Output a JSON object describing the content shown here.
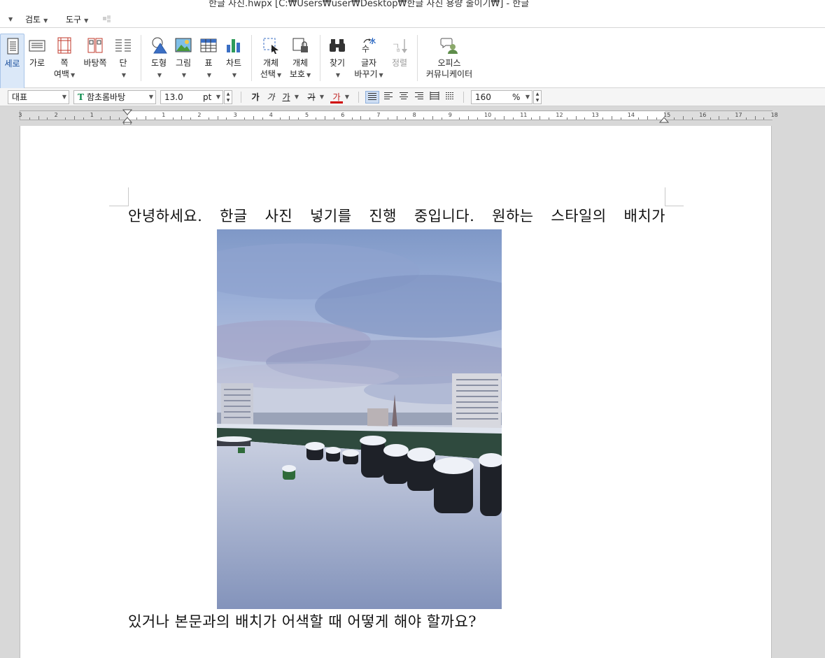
{
  "window": {
    "title": "한글 사진.hwpx [C:₩Users₩user₩Desktop₩한글 사진 용량 줄이기₩] - 한글"
  },
  "menu": {
    "items": [
      {
        "label": "검토"
      },
      {
        "label": "도구"
      }
    ]
  },
  "ribbon": {
    "buttons": [
      {
        "label": "세로",
        "icon": "portrait-page-icon"
      },
      {
        "label": "가로",
        "icon": "landscape-page-icon"
      },
      {
        "label": "쪽",
        "label2": "여백",
        "icon": "page-margin-icon"
      },
      {
        "label": "바탕쪽",
        "icon": "master-page-icon"
      },
      {
        "label": "단",
        "icon": "columns-icon"
      },
      {
        "label": "도형",
        "icon": "shape-icon"
      },
      {
        "label": "그림",
        "icon": "picture-icon"
      },
      {
        "label": "표",
        "icon": "table-icon"
      },
      {
        "label": "차트",
        "icon": "chart-icon"
      },
      {
        "label": "개체",
        "label2": "선택",
        "icon": "object-select-icon"
      },
      {
        "label": "개체",
        "label2": "보호",
        "icon": "object-protect-icon"
      },
      {
        "label": "찾기",
        "icon": "binoculars-icon"
      },
      {
        "label": "글자",
        "label2": "바꾸기",
        "icon": "char-convert-icon"
      },
      {
        "label": "정렬",
        "icon": "sort-icon"
      },
      {
        "label": "오피스",
        "label2": "커뮤니케이터",
        "icon": "office-communicator-icon"
      }
    ]
  },
  "format": {
    "style": "대표",
    "font": "함초롬바탕",
    "size": "13.0",
    "size_unit": "pt",
    "bold_label": "가",
    "italic_label": "가",
    "underline_label": "가",
    "strike_label": "가",
    "color_label": "가",
    "line_spacing": "160",
    "line_spacing_unit": "%"
  },
  "ruler": {
    "left_numbers": [
      "3",
      "2",
      "1"
    ],
    "right_numbers": [
      "1",
      "2",
      "3",
      "4",
      "5",
      "6",
      "7",
      "8",
      "9",
      "10",
      "11",
      "12",
      "13",
      "14",
      "15",
      "16",
      "17",
      "18"
    ]
  },
  "document": {
    "line1": "안녕하세요. 한글 사진 넣기를 진행 중입니다. 원하는 스타일의 배치가",
    "line2": "있거나 본문과의 배치가 어색할 때 어떻게 해야 할까요?"
  },
  "colors": {
    "accent": "#dbe8f8",
    "font_color_bar": "#d00000"
  }
}
